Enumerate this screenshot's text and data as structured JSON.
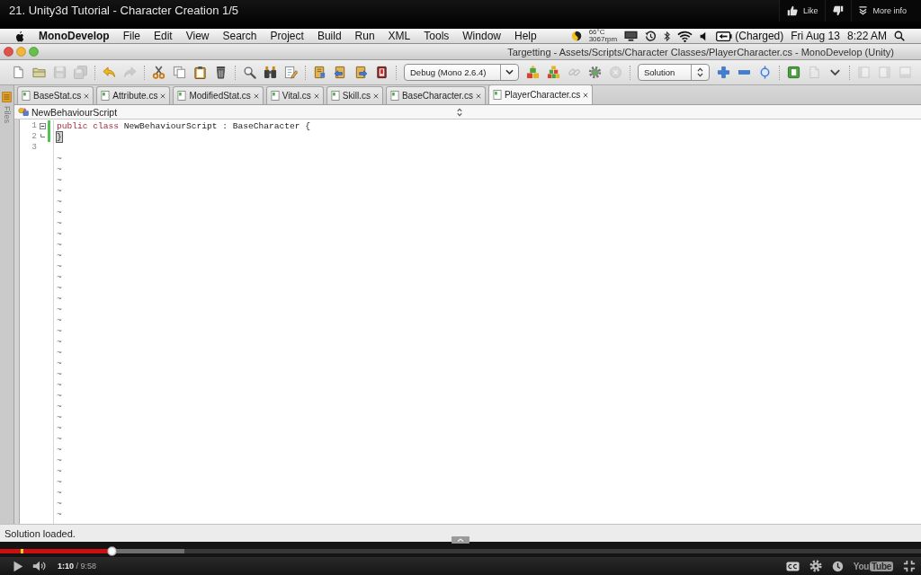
{
  "video": {
    "title": "21. Unity3d Tutorial - Character Creation 1/5",
    "actions": [
      {
        "kind": "like",
        "label": "Like"
      },
      {
        "kind": "dislike"
      },
      {
        "kind": "more",
        "label": "More info"
      }
    ]
  },
  "menu_bar": {
    "app": "MonoDevelop",
    "menus": [
      "File",
      "Edit",
      "View",
      "Search",
      "Project",
      "Build",
      "Run",
      "XML",
      "Tools",
      "Window",
      "Help"
    ],
    "temperature": "66°C",
    "fan_speed": "3067rpm",
    "battery": "(Charged)",
    "date": "Fri Aug 13",
    "time": "8:22 AM"
  },
  "window": {
    "title": "Targetting - Assets/Scripts/Character Classes/PlayerCharacter.cs - MonoDevelop (Unity)"
  },
  "toolbar": {
    "groups": [
      [
        {
          "kind": "new",
          "disabled": false
        },
        {
          "kind": "open",
          "disabled": false
        },
        {
          "kind": "save",
          "disabled": true
        },
        {
          "kind": "saveall",
          "disabled": true
        }
      ],
      [
        {
          "kind": "undo",
          "disabled": false
        },
        {
          "kind": "redo",
          "disabled": true
        }
      ],
      [
        {
          "kind": "cut",
          "disabled": false
        },
        {
          "kind": "copy",
          "disabled": false
        },
        {
          "kind": "paste",
          "disabled": false
        },
        {
          "kind": "delete",
          "disabled": false
        }
      ],
      [
        {
          "kind": "find",
          "disabled": false
        },
        {
          "kind": "findfiles",
          "disabled": false
        },
        {
          "kind": "replace",
          "disabled": false
        }
      ],
      [
        {
          "kind": "bookmark",
          "disabled": false
        },
        {
          "kind": "prevbookmark",
          "disabled": false
        },
        {
          "kind": "nextbookmark",
          "disabled": false
        },
        {
          "kind": "clearbookmarks",
          "disabled": false
        }
      ],
      [
        {
          "kind": "configuration",
          "value": "Debug (Mono 2.6.4)"
        },
        {
          "kind": "build",
          "disabled": false
        },
        {
          "kind": "rebuild",
          "disabled": false
        },
        {
          "kind": "link",
          "disabled": true
        },
        {
          "kind": "run",
          "disabled": false
        },
        {
          "kind": "stop",
          "disabled": true
        }
      ],
      [
        {
          "kind": "target",
          "value": "Solution"
        },
        {
          "kind": "add",
          "disabled": false
        },
        {
          "kind": "remove",
          "disabled": false
        },
        {
          "kind": "sync",
          "disabled": false
        }
      ],
      [
        {
          "kind": "attach",
          "disabled": false
        },
        {
          "kind": "detach",
          "disabled": true
        },
        {
          "kind": "menu",
          "disabled": false
        }
      ],
      [
        {
          "kind": "dockleft",
          "disabled": true
        },
        {
          "kind": "dockright",
          "disabled": true
        },
        {
          "kind": "dockbottom",
          "disabled": true
        }
      ]
    ]
  },
  "side_panel": {
    "label": "Files"
  },
  "tabs": [
    {
      "label": "BaseStat.cs",
      "selected": false
    },
    {
      "label": "Attribute.cs",
      "selected": false
    },
    {
      "label": "ModifiedStat.cs",
      "selected": false
    },
    {
      "label": "Vital.cs",
      "selected": false
    },
    {
      "label": "Skill.cs",
      "selected": false
    },
    {
      "label": "BaseCharacter.cs",
      "selected": false
    },
    {
      "label": "PlayerCharacter.cs",
      "selected": true
    }
  ],
  "editor": {
    "breadcrumb": "NewBehaviourScript",
    "lines": [
      {
        "number": "1",
        "fold_start": true,
        "fold_end": false,
        "changed": true,
        "current": false,
        "tokens": [
          {
            "kind": "keyword",
            "text": "public class"
          },
          {
            "kind": "plain",
            "text": "NewBehaviourScript : BaseCharacter {"
          }
        ]
      },
      {
        "number": "2",
        "fold_start": false,
        "fold_end": true,
        "changed": true,
        "current": true,
        "tokens": [
          {
            "kind": "plain",
            "text": "}"
          }
        ]
      },
      {
        "number": "3",
        "fold_start": false,
        "fold_end": false,
        "changed": false,
        "current": false
      }
    ],
    "empty_line_markers": [
      "~",
      "~",
      "~",
      "~",
      "~",
      "~",
      "~",
      "~",
      "~",
      "~",
      "~",
      "~",
      "~",
      "~",
      "~",
      "~",
      "~",
      "~",
      "~",
      "~",
      "~",
      "~",
      "~",
      "~",
      "~",
      "~",
      "~",
      "~",
      "~",
      "~",
      "~",
      "~",
      "~",
      "~"
    ]
  },
  "status_bar": {
    "message": "Solution loaded."
  },
  "player": {
    "progress": {
      "level": 0.122
    },
    "buffered": {
      "level": 0.2
    },
    "time": "**1:10** / 9:58",
    "logo": [
      "You",
      "Tube"
    ]
  }
}
